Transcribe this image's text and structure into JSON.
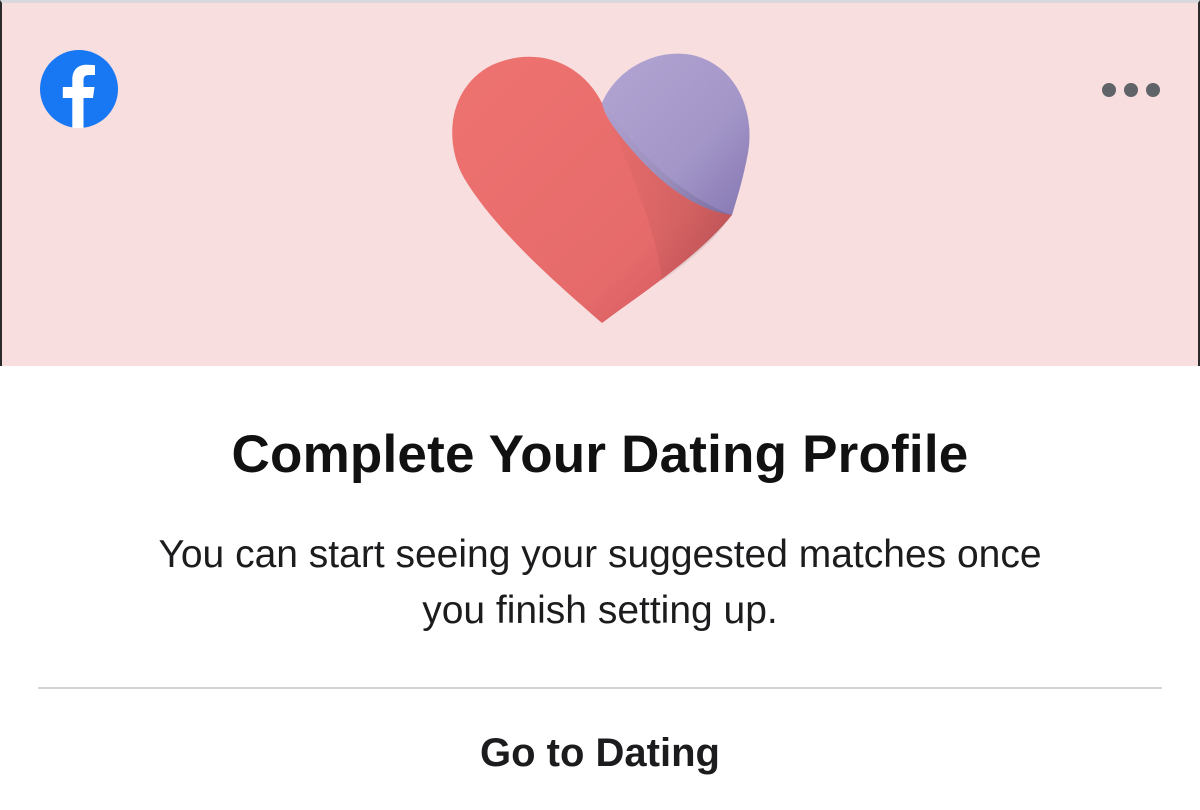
{
  "header": {
    "logo_icon": "facebook-logo-icon",
    "more_icon": "more-options-icon",
    "illustration": "heart-illustration",
    "colors": {
      "banner_background": "#f8dede",
      "facebook_blue": "#1877f2",
      "heart_red": "#e86b6b",
      "heart_purple": "#a99bcc"
    }
  },
  "main": {
    "title": "Complete Your Dating Profile",
    "subtitle": "You can start seeing your suggested matches once you finish setting up."
  },
  "actions": {
    "go_to_dating_label": "Go to Dating"
  }
}
